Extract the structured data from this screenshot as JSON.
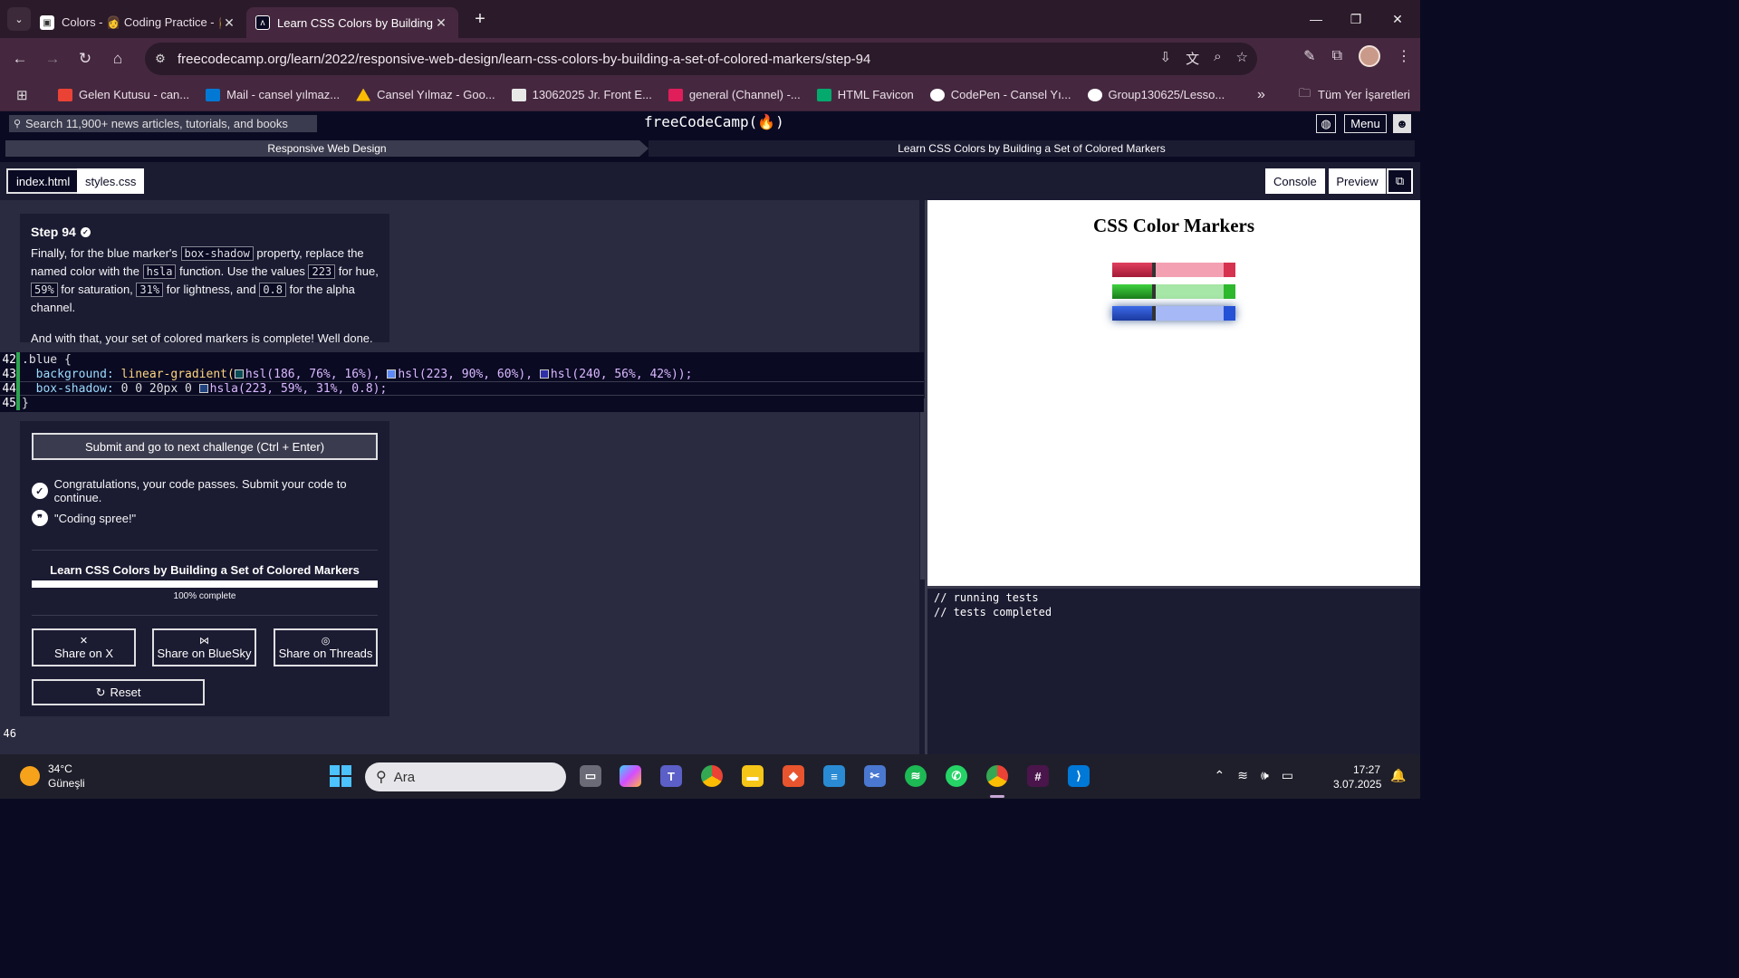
{
  "browser": {
    "tabs": [
      {
        "title": "Colors - 👩 Coding Practice - 👩",
        "active": false
      },
      {
        "title": "Learn CSS Colors by Building a",
        "active": true
      }
    ],
    "url": "freecodecamp.org/learn/2022/responsive-web-design/learn-css-colors-by-building-a-set-of-colored-markers/step-94",
    "bookmarks": [
      {
        "label": "Gelen Kutusu  - can...",
        "color": "#ea4335"
      },
      {
        "label": "Mail - cansel yılmaz...",
        "color": "#0078d4"
      },
      {
        "label": "Cansel Yılmaz - Goo...",
        "color": "#fbbc04"
      },
      {
        "label": "13062025 Jr. Front E...",
        "color": "#e8e8e8"
      },
      {
        "label": "general (Channel) -...",
        "color": "#e01e5a"
      },
      {
        "label": "HTML Favicon",
        "color": "#04aa6d"
      },
      {
        "label": "CodePen - Cansel Yı...",
        "color": "#ffffff"
      },
      {
        "label": "Group130625/Lesso...",
        "color": "#ffffff"
      }
    ],
    "all_bookmarks": "Tüm Yer İşaretleri"
  },
  "fcc": {
    "search_placeholder": "Search 11,900+ news articles, tutorials, and books",
    "logo": "freeCodeCamp(🔥)",
    "menu_label": "Menu",
    "breadcrumb_1": "Responsive Web Design",
    "breadcrumb_2": "Learn CSS Colors by Building a Set of Colored Markers"
  },
  "editor": {
    "file_tabs": [
      "index.html",
      "styles.css"
    ],
    "console_btn": "Console",
    "preview_btn": "Preview"
  },
  "instructions": {
    "title": "Step 94",
    "p1_a": "Finally, for the blue marker's ",
    "p1_code1": "box-shadow",
    "p1_b": " property, replace the named color with the ",
    "p1_code2": "hsla",
    "p1_c": " function. Use the values ",
    "p1_code3": "223",
    "p1_d": " for hue, ",
    "p1_code4": "59%",
    "p1_e": " for saturation, ",
    "p1_code5": "31%",
    "p1_f": " for lightness, and ",
    "p1_code6": "0.8",
    "p1_g": " for the alpha channel.",
    "p2": "And with that, your set of colored markers is complete! Well done."
  },
  "code": {
    "lines": [
      {
        "num": "42",
        "text": ".blue {"
      },
      {
        "num": "43",
        "text": "  background: linear-gradient( hsl(186, 76%, 16%),  hsl(223, 90%, 60%),  hsl(240, 56%, 42%));"
      },
      {
        "num": "44",
        "text": "  box-shadow: 0 0 20px 0  hsla(223, 59%, 31%, 0.8);"
      },
      {
        "num": "45",
        "text": "}"
      }
    ],
    "l43_prefix": "background: ",
    "l43_fn": "linear-gradient(",
    "l43_a": "hsl(186, 76%, 16%), ",
    "l43_b": "hsl(223, 90%, 60%), ",
    "l43_c": "hsl(240, 56%, 42%));",
    "l44_prefix": "box-shadow: ",
    "l44_val": "0 0 20px 0 ",
    "l44_fn": "hsla(223, 59%, 31%, 0.8);",
    "swatches": [
      "#0a4d56",
      "#5c89f5",
      "#2f2fa7",
      "#214480"
    ],
    "line_after": "46"
  },
  "result": {
    "submit_label": "Submit and go to next challenge (Ctrl + Enter)",
    "pass_msg": "Congratulations, your code passes. Submit your code to continue.",
    "quote": "\"Coding spree!\"",
    "progress_title": "Learn CSS Colors by Building a Set of Colored Markers",
    "progress_pct": 100,
    "progress_text": "100% complete",
    "share_x": "Share on X",
    "share_bluesky": "Share on BlueSky",
    "share_threads": "Share on Threads",
    "reset": "Reset"
  },
  "preview": {
    "title": "CSS Color Markers",
    "markers": [
      {
        "cap": "#d63350",
        "body": "#f4a0b3"
      },
      {
        "cap": "#2eb82e",
        "body": "#a6e6a6"
      },
      {
        "cap": "#2451d6",
        "body": "#a6b8f5"
      }
    ]
  },
  "console": {
    "lines": [
      "// running tests",
      "// tests completed"
    ]
  },
  "taskbar": {
    "temp": "34°C",
    "weather": "Güneşli",
    "search_placeholder": "Ara",
    "time": "17:27",
    "date": "3.07.2025"
  }
}
